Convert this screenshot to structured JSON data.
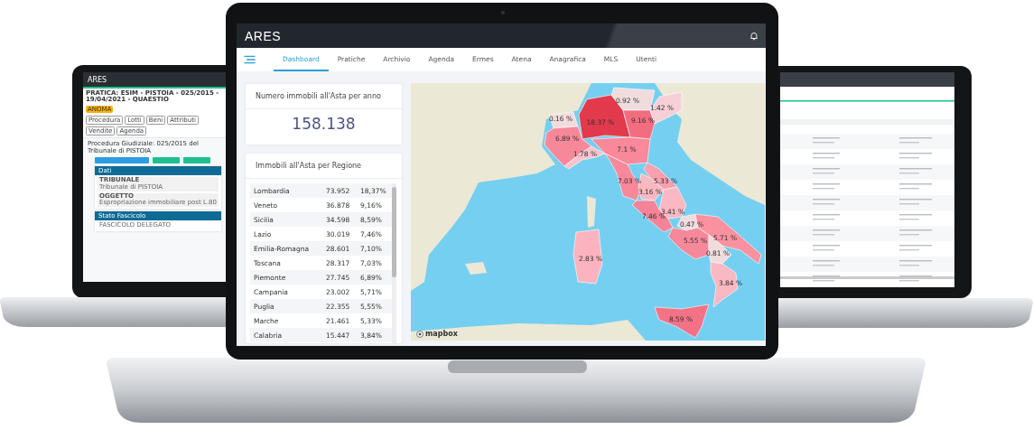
{
  "left_laptop": {
    "logo": "ARES",
    "title": "PRATICA: ESIM - PISTOIA - 025/2015 - 19/04/2021 - QUAESTIO",
    "badge": "ANOMA",
    "tabs": [
      {
        "label": "Procedura",
        "selected": false
      },
      {
        "label": "Lotti",
        "selected": false
      },
      {
        "label": "Beni",
        "selected": false
      },
      {
        "label": "Attributi",
        "selected": false
      },
      {
        "label": "Vendite",
        "selected": false
      },
      {
        "label": "Agenda",
        "selected": false
      }
    ],
    "heading": "Procedura Giudiziale: 025/2015 del Tribunale di PISTOIA",
    "panels": [
      {
        "title": "Dati",
        "fields": [
          {
            "label": "TRIBUNALE",
            "value": "Tribunale di PISTOIA"
          },
          {
            "label": "OGGETTO",
            "value": "Espropriazione immobiliare post L.80"
          }
        ]
      },
      {
        "title": "Stato Fascicolo",
        "fields": [
          {
            "value": "FASCICOLO DELEGATO"
          }
        ]
      }
    ]
  },
  "center_laptop": {
    "logo": "ARES",
    "nav_tabs": [
      {
        "label": "Dashboard",
        "selected": true
      },
      {
        "label": "Pratiche",
        "selected": false
      },
      {
        "label": "Archivio",
        "selected": false
      },
      {
        "label": "Agenda",
        "selected": false
      },
      {
        "label": "Ermes",
        "selected": false
      },
      {
        "label": "Atena",
        "selected": false
      },
      {
        "label": "Anagrafica",
        "selected": false
      },
      {
        "label": "MLS",
        "selected": false
      },
      {
        "label": "Utenti",
        "selected": false
      }
    ],
    "total_card": {
      "title": "Numero immobili all'Asta per anno",
      "value": "158.138"
    },
    "region_table": {
      "title": "Immobili all'Asta per Regione",
      "rows": [
        {
          "region": "Lombardia",
          "count": "73.952",
          "share": "18,37%"
        },
        {
          "region": "Veneto",
          "count": "36.878",
          "share": "9,16%"
        },
        {
          "region": "Sicilia",
          "count": "34.598",
          "share": "8,59%"
        },
        {
          "region": "Lazio",
          "count": "30.019",
          "share": "7,46%"
        },
        {
          "region": "Emilia-Romagna",
          "count": "28.601",
          "share": "7,10%"
        },
        {
          "region": "Toscana",
          "count": "28.317",
          "share": "7,03%"
        },
        {
          "region": "Piemonte",
          "count": "27.745",
          "share": "6,89%"
        },
        {
          "region": "Campania",
          "count": "23.002",
          "share": "5,71%"
        },
        {
          "region": "Puglia",
          "count": "22.355",
          "share": "5,55%"
        },
        {
          "region": "Marche",
          "count": "21.461",
          "share": "5,33%"
        },
        {
          "region": "Calabria",
          "count": "15.447",
          "share": "3,84%"
        }
      ]
    },
    "map": {
      "attribution": "mapbox",
      "regions": [
        {
          "label": "0.16 %",
          "color": "#f2dcdc"
        },
        {
          "label": "6.89 %",
          "color": "#f7889a"
        },
        {
          "label": "18.37 %",
          "color": "#e23a4c"
        },
        {
          "label": "0.92 %",
          "color": "#f0dcdd"
        },
        {
          "label": "9.16 %",
          "color": "#f26d80"
        },
        {
          "label": "1.42 %",
          "color": "#f6d0d6"
        },
        {
          "label": "1.78 %",
          "color": "#f9c3cb"
        },
        {
          "label": "7.1 %",
          "color": "#f8889a"
        },
        {
          "label": "7.03 %",
          "color": "#f8889a"
        },
        {
          "label": "5.33 %",
          "color": "#f9a0ad"
        },
        {
          "label": "3.16 %",
          "color": "#fab8c2"
        },
        {
          "label": "3.41 %",
          "color": "#fab8c2"
        },
        {
          "label": "7.46 %",
          "color": "#f58397"
        },
        {
          "label": "0.47 %",
          "color": "#f0dcdd"
        },
        {
          "label": "5.71 %",
          "color": "#f7889a"
        },
        {
          "label": "5.55 %",
          "color": "#f9919f"
        },
        {
          "label": "0.81 %",
          "color": "#f0dcdd"
        },
        {
          "label": "3.84 %",
          "color": "#fab8c2"
        },
        {
          "label": "8.59 %",
          "color": "#f37286"
        },
        {
          "label": "2.83 %",
          "color": "#fbb4bf"
        }
      ]
    }
  }
}
